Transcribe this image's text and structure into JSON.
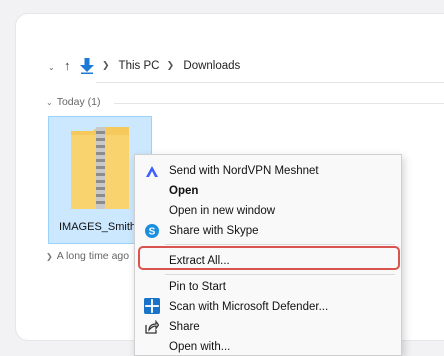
{
  "breadcrumb": {
    "items": [
      "This PC",
      "Downloads"
    ]
  },
  "groups": {
    "today": "Today (1)",
    "older": "A long time ago"
  },
  "file": {
    "name": "IMAGES_Smith"
  },
  "context_menu": {
    "items": [
      {
        "label": "Send with NordVPN Meshnet",
        "icon": "nordvpn-icon"
      },
      {
        "label": "Open",
        "bold": true
      },
      {
        "label": "Open in new window"
      },
      {
        "label": "Share with Skype",
        "icon": "skype-icon"
      },
      {
        "label": "Extract All...",
        "highlighted": true
      },
      {
        "label": "Pin to Start"
      },
      {
        "label": "Scan with Microsoft Defender...",
        "icon": "defender-icon"
      },
      {
        "label": "Share",
        "icon": "share-icon"
      },
      {
        "label": "Open with..."
      }
    ]
  },
  "colors": {
    "selection_fill": "#cce8ff",
    "highlight_border": "#d9534f",
    "accent_blue": "#1e78d6"
  }
}
